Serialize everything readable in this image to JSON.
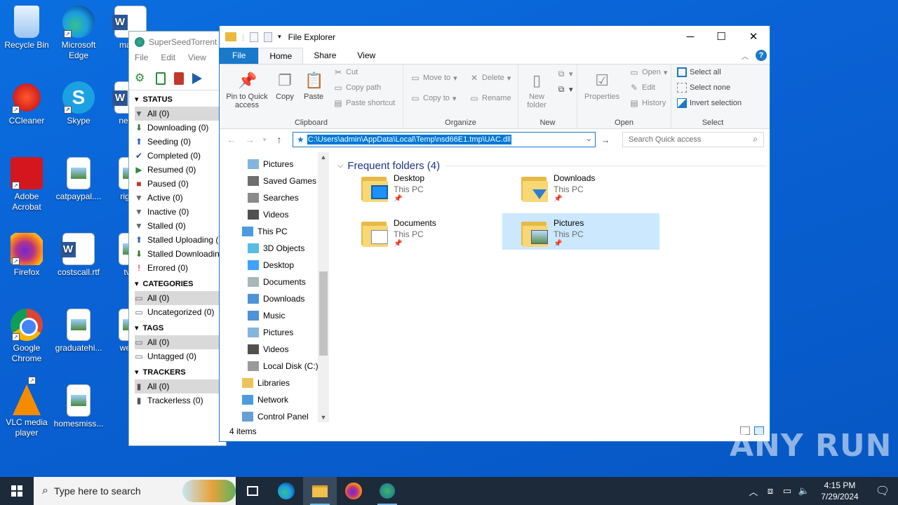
{
  "desktop": {
    "icons": [
      {
        "label": "Recycle Bin",
        "icon": "recycle-bin-icon"
      },
      {
        "label": "Microsoft Edge",
        "icon": "edge-icon"
      },
      {
        "label": "maxin",
        "icon": "word-doc-icon"
      },
      {
        "label": "CCleaner",
        "icon": "ccleaner-icon"
      },
      {
        "label": "Skype",
        "icon": "skype-icon"
      },
      {
        "label": "neede",
        "icon": "word-doc-icon"
      },
      {
        "label": "Adobe Acrobat",
        "icon": "acrobat-icon"
      },
      {
        "label": "catpaypal....",
        "icon": "image-file-icon"
      },
      {
        "label": "rights",
        "icon": "image-file-icon"
      },
      {
        "label": "Firefox",
        "icon": "firefox-icon"
      },
      {
        "label": "costscall.rtf",
        "icon": "word-doc-icon"
      },
      {
        "label": "tvfir",
        "icon": "image-file-icon"
      },
      {
        "label": "Google Chrome",
        "icon": "chrome-icon"
      },
      {
        "label": "graduatehi...",
        "icon": "image-file-icon"
      },
      {
        "label": "welco",
        "icon": "image-file-icon"
      },
      {
        "label": "VLC media player",
        "icon": "vlc-icon"
      },
      {
        "label": "homesmiss...",
        "icon": "image-file-icon"
      }
    ]
  },
  "superseed": {
    "title": "SuperSeedTorrent v",
    "menu": [
      "File",
      "Edit",
      "View",
      "To"
    ],
    "sections": [
      {
        "header": "STATUS",
        "items": [
          {
            "label": "All (0)",
            "selected": true,
            "icon": "filter-icon"
          },
          {
            "label": "Downloading (0)",
            "icon": "arrow-down-icon"
          },
          {
            "label": "Seeding (0)",
            "icon": "arrow-up-icon"
          },
          {
            "label": "Completed (0)",
            "icon": "check-icon"
          },
          {
            "label": "Resumed (0)",
            "icon": "play-icon"
          },
          {
            "label": "Paused (0)",
            "icon": "pause-icon"
          },
          {
            "label": "Active (0)",
            "icon": "filter-icon"
          },
          {
            "label": "Inactive (0)",
            "icon": "filter-icon"
          },
          {
            "label": "Stalled (0)",
            "icon": "filter-icon"
          },
          {
            "label": "Stalled Uploading (",
            "icon": "arrow-up-icon"
          },
          {
            "label": "Stalled Downloadin",
            "icon": "arrow-down-icon"
          },
          {
            "label": "Errored (0)",
            "icon": "error-icon"
          }
        ]
      },
      {
        "header": "CATEGORIES",
        "items": [
          {
            "label": "All (0)",
            "selected": true,
            "icon": "folder-icon"
          },
          {
            "label": "Uncategorized (0)",
            "icon": "folder-icon"
          }
        ]
      },
      {
        "header": "TAGS",
        "items": [
          {
            "label": "All (0)",
            "selected": true,
            "icon": "folder-icon"
          },
          {
            "label": "Untagged (0)",
            "icon": "folder-icon"
          }
        ]
      },
      {
        "header": "TRACKERS",
        "items": [
          {
            "label": "All (0)",
            "selected": true,
            "icon": "server-icon"
          },
          {
            "label": "Trackerless (0)",
            "icon": "server-icon"
          }
        ]
      }
    ]
  },
  "explorer": {
    "title": "File Explorer",
    "tabs": {
      "file": "File",
      "home": "Home",
      "share": "Share",
      "view": "View"
    },
    "ribbon": {
      "clipboard": {
        "label": "Clipboard",
        "pin": "Pin to Quick access",
        "copy": "Copy",
        "paste": "Paste",
        "cut": "Cut",
        "copy_path": "Copy path",
        "paste_shortcut": "Paste shortcut"
      },
      "organize": {
        "label": "Organize",
        "move_to": "Move to",
        "copy_to": "Copy to",
        "delete": "Delete",
        "rename": "Rename"
      },
      "new": {
        "label": "New",
        "new_folder": "New folder"
      },
      "open": {
        "label": "Open",
        "properties": "Properties",
        "open": "Open",
        "edit": "Edit",
        "history": "History"
      },
      "select": {
        "label": "Select",
        "select_all": "Select all",
        "select_none": "Select none",
        "invert": "Invert selection"
      }
    },
    "address": "C:\\Users\\admin\\AppData\\Local\\Temp\\nsd66E1.tmp\\UAC.dll",
    "search_placeholder": "Search Quick access",
    "nav_items": [
      {
        "label": "Pictures",
        "indent": 1,
        "icon": "pictures-icon"
      },
      {
        "label": "Saved Games",
        "indent": 1,
        "icon": "saved-games-icon"
      },
      {
        "label": "Searches",
        "indent": 1,
        "icon": "search-icon"
      },
      {
        "label": "Videos",
        "indent": 1,
        "icon": "videos-icon"
      },
      {
        "label": "This PC",
        "indent": 0,
        "icon": "this-pc-icon"
      },
      {
        "label": "3D Objects",
        "indent": 1,
        "icon": "3d-objects-icon"
      },
      {
        "label": "Desktop",
        "indent": 1,
        "icon": "desktop-icon"
      },
      {
        "label": "Documents",
        "indent": 1,
        "icon": "documents-icon"
      },
      {
        "label": "Downloads",
        "indent": 1,
        "icon": "downloads-icon"
      },
      {
        "label": "Music",
        "indent": 1,
        "icon": "music-icon"
      },
      {
        "label": "Pictures",
        "indent": 1,
        "icon": "pictures-icon"
      },
      {
        "label": "Videos",
        "indent": 1,
        "icon": "videos-icon"
      },
      {
        "label": "Local Disk (C:)",
        "indent": 1,
        "icon": "drive-icon"
      },
      {
        "label": "Libraries",
        "indent": 0,
        "icon": "libraries-icon"
      },
      {
        "label": "Network",
        "indent": 0,
        "icon": "network-icon"
      },
      {
        "label": "Control Panel",
        "indent": 0,
        "icon": "control-panel-icon"
      }
    ],
    "group_title": "Frequent folders (4)",
    "folders": [
      {
        "name": "Desktop",
        "location": "This PC",
        "selected": false,
        "badge": "desktop"
      },
      {
        "name": "Downloads",
        "location": "This PC",
        "selected": false,
        "badge": "downloads"
      },
      {
        "name": "Documents",
        "location": "This PC",
        "selected": false,
        "badge": "documents"
      },
      {
        "name": "Pictures",
        "location": "This PC",
        "selected": true,
        "badge": "pictures"
      }
    ],
    "status": "4 items",
    "colors": {
      "accent": "#1979ca",
      "selection": "#cce8ff",
      "address_highlight": "#0078d7"
    }
  },
  "taskbar": {
    "search_placeholder": "Type here to search",
    "time": "4:15 PM",
    "date": "7/29/2024"
  },
  "watermark": "ANY RUN"
}
